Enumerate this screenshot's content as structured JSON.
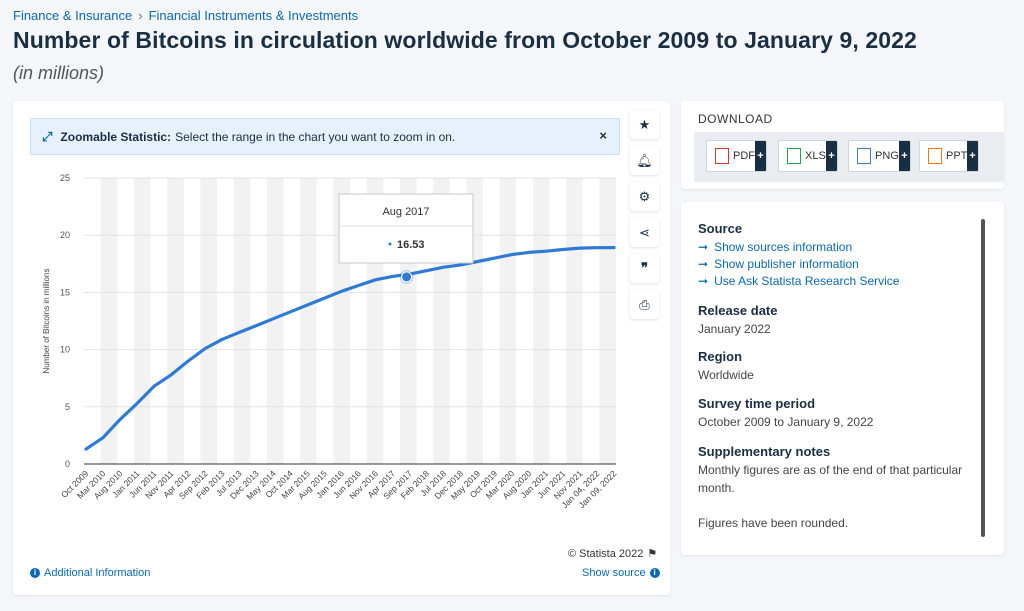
{
  "breadcrumb": [
    "Finance & Insurance",
    "Financial Instruments & Investments"
  ],
  "breadcrumb_sep": "›",
  "title": "Number of Bitcoins in circulation worldwide from October 2009 to January 9, 2022",
  "subtitle": "(in millions)",
  "zoom_banner": {
    "label": "Zoomable Statistic:",
    "text": "Select the range in the chart you want to zoom in on.",
    "close": "×"
  },
  "tools": [
    "star-icon",
    "bell-icon",
    "gear-icon",
    "share-icon",
    "quote-icon",
    "print-icon"
  ],
  "tooltip": {
    "period": "Aug 2017",
    "value": "16.53"
  },
  "footer": {
    "additional_info": "Additional Information",
    "copyright": "© Statista 2022",
    "show_source": "Show source"
  },
  "download": {
    "title": "DOWNLOAD",
    "buttons": [
      {
        "label": "PDF",
        "color": "#d9342b"
      },
      {
        "label": "XLS",
        "color": "#2f9e44"
      },
      {
        "label": "PNG",
        "color": "#3b7dd8"
      },
      {
        "label": "PPT",
        "color": "#e57c1f"
      }
    ]
  },
  "info": {
    "source_heading": "Source",
    "source_links": [
      "Show sources information",
      "Show publisher information",
      "Use Ask Statista Research Service"
    ],
    "release_heading": "Release date",
    "release_value": "January 2022",
    "region_heading": "Region",
    "region_value": "Worldwide",
    "period_heading": "Survey time period",
    "period_value": "October 2009 to January 9, 2022",
    "notes_heading": "Supplementary notes",
    "notes_value": "Monthly figures are as of the end of that particular month.",
    "notes_value2": "Figures have been rounded."
  },
  "colors": {
    "accent": "#0b68b5",
    "line": "#2f7ad6",
    "navy": "#1a2e44"
  },
  "chart_data": {
    "type": "line",
    "title": "",
    "xlabel": "",
    "ylabel": "Number of Bitcoins in millions",
    "ylim": [
      0,
      25
    ],
    "yticks": [
      0,
      5,
      10,
      15,
      20,
      25
    ],
    "grid": true,
    "categories": [
      "Oct 2009",
      "Mar 2010",
      "Aug 2010",
      "Jan 2011",
      "Jun 2011",
      "Nov 2011",
      "Apr 2012",
      "Sep 2012",
      "Feb 2013",
      "Jul 2013",
      "Dec 2013",
      "May 2014",
      "Oct 2014",
      "Mar 2015",
      "Aug 2015",
      "Jan 2016",
      "Jun 2016",
      "Nov 2016",
      "Apr 2017",
      "Sep 2017",
      "Feb 2018",
      "Jul 2018",
      "Dec 2018",
      "May 2019",
      "Oct 2019",
      "Mar 2020",
      "Aug 2020",
      "Jan 2021",
      "Jun 2021",
      "Nov 2021",
      "Jan 04, 2022",
      "Jan 09, 2022"
    ],
    "series": [
      {
        "values": [
          1.3,
          2.3,
          3.9,
          5.3,
          6.8,
          7.8,
          9.0,
          10.1,
          10.9,
          11.5,
          12.1,
          12.7,
          13.3,
          13.9,
          14.5,
          15.1,
          15.6,
          16.1,
          16.4,
          16.6,
          16.9,
          17.2,
          17.4,
          17.7,
          18.0,
          18.3,
          18.5,
          18.6,
          18.75,
          18.87,
          18.91,
          18.92
        ]
      }
    ],
    "highlight": {
      "index": 19,
      "category": "Aug 2017",
      "value": 16.53
    }
  }
}
